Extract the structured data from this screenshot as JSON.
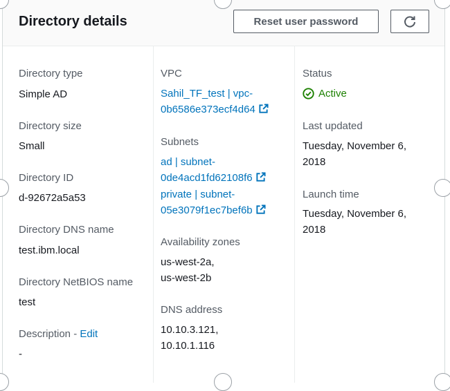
{
  "header": {
    "title": "Directory details",
    "reset_password_label": "Reset user password",
    "refresh_icon": "refresh-icon"
  },
  "col1": {
    "directory_type_label": "Directory type",
    "directory_type_value": "Simple AD",
    "directory_size_label": "Directory size",
    "directory_size_value": "Small",
    "directory_id_label": "Directory ID",
    "directory_id_value": "d-92672a5a53",
    "dns_name_label": "Directory DNS name",
    "dns_name_value": "test.ibm.local",
    "netbios_label": "Directory NetBIOS name",
    "netbios_value": "test",
    "description_label": "Description - ",
    "description_edit": "Edit",
    "description_value": "-"
  },
  "col2": {
    "vpc_label": "VPC",
    "vpc_line1": "Sahil_TF_test | vpc-",
    "vpc_line2": "0b6586e373ecf4d64",
    "subnets_label": "Subnets",
    "subnet1_line1": "ad | subnet-",
    "subnet1_line2": "0de4acd1fd62108f6",
    "subnet2_line1": "private | subnet-",
    "subnet2_line2": "05e3079f1ec7bef6b",
    "az_label": "Availability zones",
    "az_line1": "us-west-2a,",
    "az_line2": "us-west-2b",
    "dns_address_label": "DNS address",
    "dns_line1": "10.10.3.121,",
    "dns_line2": "10.10.1.116"
  },
  "col3": {
    "status_label": "Status",
    "status_value": "Active",
    "last_updated_label": "Last updated",
    "last_updated_line1": "Tuesday, November 6,",
    "last_updated_line2": "2018",
    "launch_time_label": "Launch time",
    "launch_time_line1": "Tuesday, November 6,",
    "launch_time_line2": "2018"
  },
  "colors": {
    "link": "#0073bb",
    "success": "#1d8102",
    "label": "#545b64"
  }
}
